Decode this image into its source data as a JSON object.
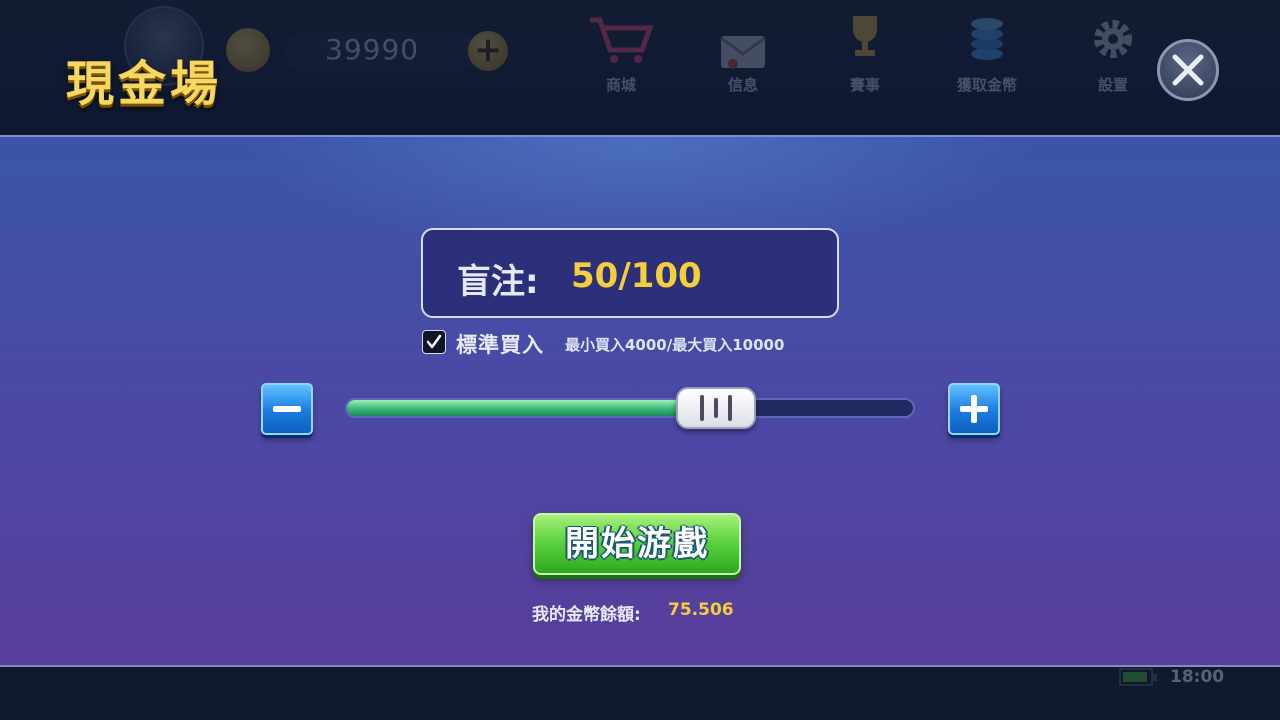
{
  "header": {
    "title": "現金場",
    "coin_balance": "39990",
    "nav": [
      {
        "label": "商城",
        "icon": "shopping-cart-icon"
      },
      {
        "label": "信息",
        "icon": "envelope-icon"
      },
      {
        "label": "賽事",
        "icon": "trophy-icon"
      },
      {
        "label": "獲取金幣",
        "icon": "chip-stack-icon"
      },
      {
        "label": "設置",
        "icon": "gear-icon"
      }
    ],
    "close_icon": "close-icon"
  },
  "panel": {
    "blind_label": "盲注:",
    "blind_value": "50/100",
    "standard_buyin_checked": true,
    "standard_buyin_label": "標準買入",
    "buyin_range": "最小買入4000/最大買入10000",
    "slider_fraction": 0.65,
    "start_button": "開始游戲",
    "balance_label": "我的金幣餘額:",
    "balance_value": "75.506"
  },
  "status": {
    "time": "18:00"
  },
  "colors": {
    "title_gold": "#f6d75f",
    "value_gold": "#f4cf3b",
    "start_green": "#57d03a",
    "stepper_blue": "#1a7be0",
    "slider_green": "#39b877"
  }
}
